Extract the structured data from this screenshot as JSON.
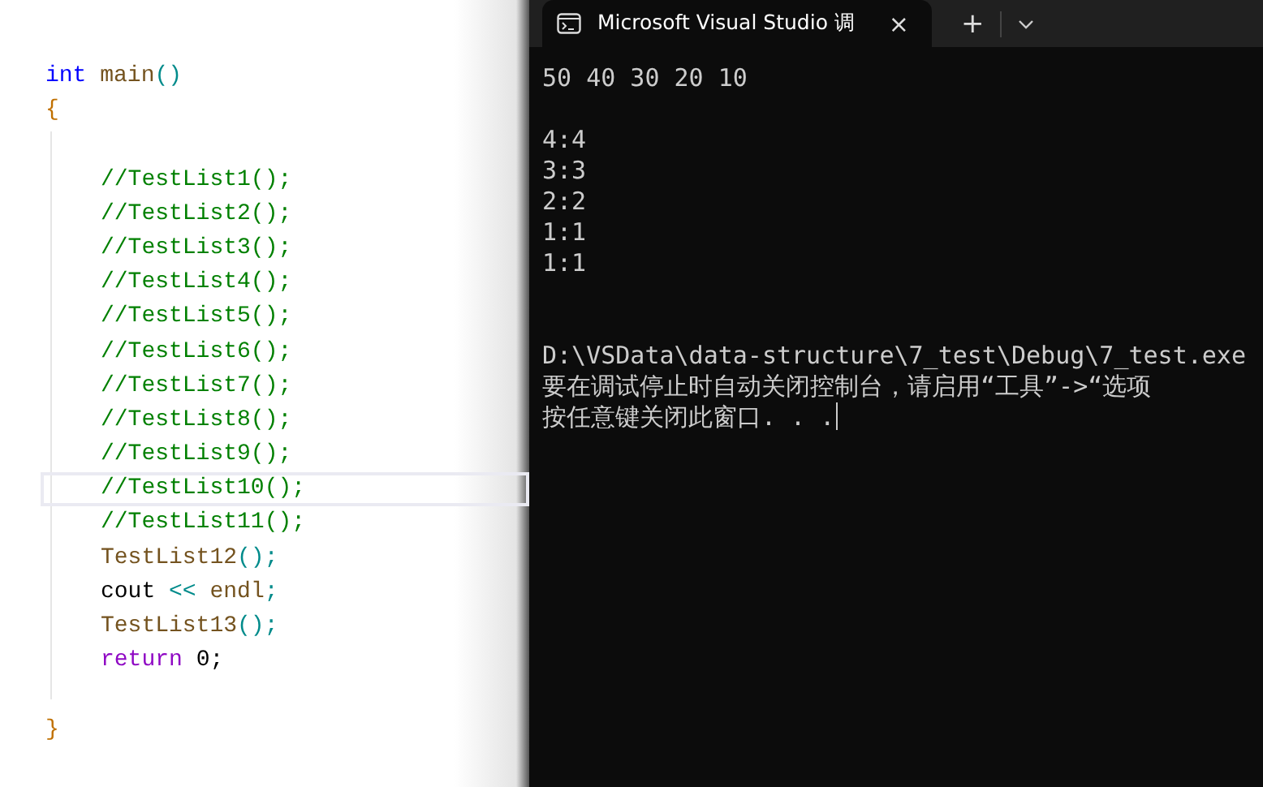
{
  "editor": {
    "lines": [
      {
        "kind": "top",
        "current": false,
        "tokens": [
          {
            "kind": "keyword",
            "text": "int "
          },
          {
            "kind": "function",
            "text": "main"
          },
          {
            "kind": "punct",
            "text": "()"
          }
        ]
      },
      {
        "kind": "top",
        "current": false,
        "tokens": [
          {
            "kind": "brace",
            "text": "{"
          }
        ]
      },
      {
        "kind": "blank"
      },
      {
        "kind": "body",
        "current": false,
        "tokens": [
          {
            "kind": "comment",
            "text": "//TestList1();"
          }
        ]
      },
      {
        "kind": "body",
        "current": false,
        "tokens": [
          {
            "kind": "comment",
            "text": "//TestList2();"
          }
        ]
      },
      {
        "kind": "body",
        "current": false,
        "tokens": [
          {
            "kind": "comment",
            "text": "//TestList3();"
          }
        ]
      },
      {
        "kind": "body",
        "current": false,
        "tokens": [
          {
            "kind": "comment",
            "text": "//TestList4();"
          }
        ]
      },
      {
        "kind": "body",
        "current": false,
        "tokens": [
          {
            "kind": "comment",
            "text": "//TestList5();"
          }
        ]
      },
      {
        "kind": "body",
        "current": false,
        "tokens": [
          {
            "kind": "comment",
            "text": "//TestList6();"
          }
        ]
      },
      {
        "kind": "body",
        "current": false,
        "tokens": [
          {
            "kind": "comment",
            "text": "//TestList7();"
          }
        ]
      },
      {
        "kind": "body",
        "current": false,
        "tokens": [
          {
            "kind": "comment",
            "text": "//TestList8();"
          }
        ]
      },
      {
        "kind": "body",
        "current": false,
        "tokens": [
          {
            "kind": "comment",
            "text": "//TestList9();"
          }
        ]
      },
      {
        "kind": "body",
        "current": true,
        "tokens": [
          {
            "kind": "comment",
            "text": "//TestList10();"
          }
        ]
      },
      {
        "kind": "body",
        "current": false,
        "tokens": [
          {
            "kind": "comment",
            "text": "//TestList11();"
          }
        ]
      },
      {
        "kind": "body",
        "current": false,
        "tokens": [
          {
            "kind": "function",
            "text": "TestList12"
          },
          {
            "kind": "punct",
            "text": "();"
          }
        ]
      },
      {
        "kind": "body",
        "current": false,
        "tokens": [
          {
            "kind": "plain",
            "text": "cout "
          },
          {
            "kind": "punct",
            "text": "<< "
          },
          {
            "kind": "function",
            "text": "endl"
          },
          {
            "kind": "punct",
            "text": ";"
          }
        ]
      },
      {
        "kind": "body",
        "current": false,
        "tokens": [
          {
            "kind": "function",
            "text": "TestList13"
          },
          {
            "kind": "punct",
            "text": "();"
          }
        ]
      },
      {
        "kind": "body",
        "current": false,
        "tokens": [
          {
            "kind": "control",
            "text": "return "
          },
          {
            "kind": "plain",
            "text": "0;"
          }
        ]
      },
      {
        "kind": "blank"
      },
      {
        "kind": "top",
        "current": false,
        "tokens": [
          {
            "kind": "brace",
            "text": "}"
          }
        ]
      }
    ]
  },
  "terminal": {
    "tab": {
      "title": "Microsoft Visual Studio 调",
      "close": "×",
      "new_tab": "+"
    },
    "lines": [
      {
        "kind": "text",
        "text": "50 40 30 20 10"
      },
      {
        "kind": "blank"
      },
      {
        "kind": "text",
        "text": "4:4"
      },
      {
        "kind": "text",
        "text": "3:3"
      },
      {
        "kind": "text",
        "text": "2:2"
      },
      {
        "kind": "text",
        "text": "1:1"
      },
      {
        "kind": "text",
        "text": "1:1"
      },
      {
        "kind": "blank"
      },
      {
        "kind": "blank"
      },
      {
        "kind": "text",
        "text": "D:\\VSData\\data-structure\\7_test\\Debug\\7_test.exe"
      },
      {
        "kind": "text",
        "text": "要在调试停止时自动关闭控制台，请启用“工具”->“选项"
      },
      {
        "kind": "prompt",
        "text": "按任意键关闭此窗口. . ."
      }
    ]
  }
}
